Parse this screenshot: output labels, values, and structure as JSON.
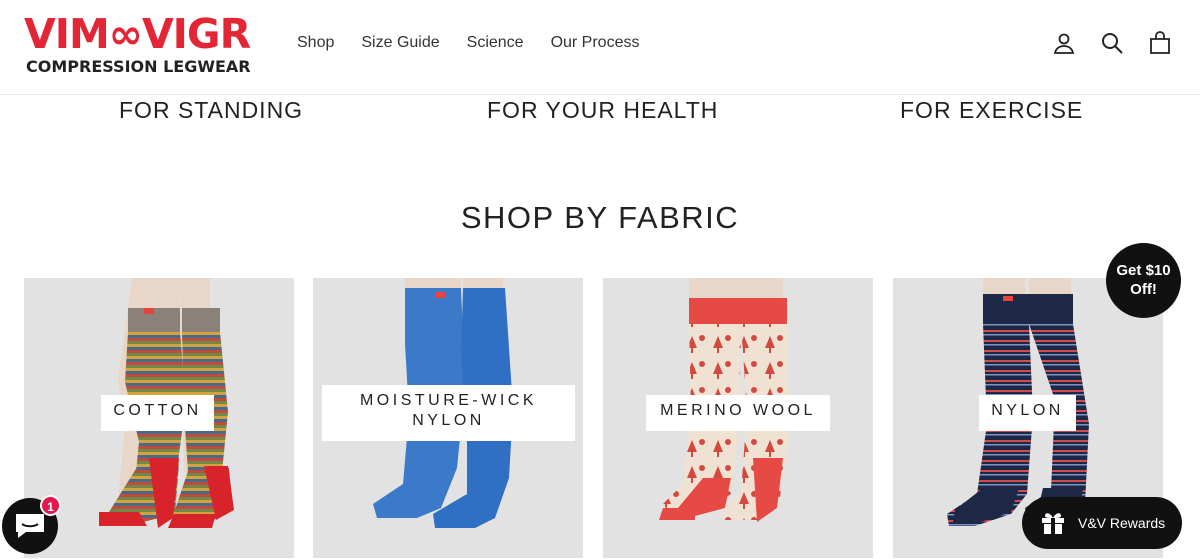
{
  "brand": {
    "name": "VIM&VIGR",
    "logo_word": "VIM∞VIGR",
    "tagline": "COMPRESSION LEGWEAR",
    "color": "#e32636"
  },
  "nav": {
    "items": [
      "Shop",
      "Size Guide",
      "Science",
      "Our Process"
    ]
  },
  "header_icons": [
    "account-icon",
    "search-icon",
    "cart-icon"
  ],
  "purposes": [
    "FOR STANDING",
    "FOR YOUR HEALTH",
    "FOR EXERCISE"
  ],
  "section": {
    "title": "SHOP BY FABRIC"
  },
  "fabrics": [
    {
      "label": "COTTON",
      "sock": "multicolor-stripe"
    },
    {
      "label_line1": "MOISTURE-WICK",
      "label_line2": "NYLON",
      "sock": "solid-blue"
    },
    {
      "label": "MERINO WOOL",
      "sock": "cream-red-forest-print"
    },
    {
      "label": "NYLON",
      "sock": "navy-stripe"
    }
  ],
  "promo": {
    "line1": "Get $10",
    "line2": "Off!"
  },
  "rewards": {
    "label": "V&V Rewards"
  },
  "chat": {
    "badge_count": "1"
  }
}
